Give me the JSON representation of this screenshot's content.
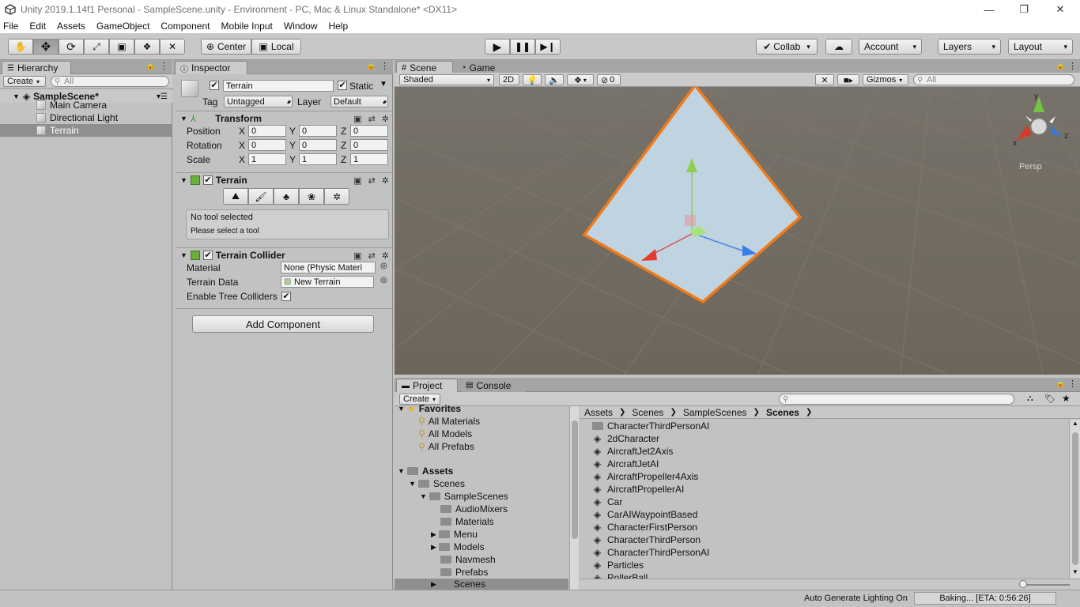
{
  "window": {
    "title": "Unity 2019.1.14f1 Personal - SampleScene.unity - Environment - PC, Mac & Linux Standalone* <DX11>",
    "minimize": "—",
    "restore": "❐",
    "close": "✕"
  },
  "menu": [
    "File",
    "Edit",
    "Assets",
    "GameObject",
    "Component",
    "Mobile Input",
    "Window",
    "Help"
  ],
  "toolbar": {
    "center": "Center",
    "local": "Local",
    "collab": "Collab",
    "account": "Account",
    "layers": "Layers",
    "layout": "Layout"
  },
  "hierarchy": {
    "tab": "Hierarchy",
    "create": "Create",
    "search_placeholder": "All",
    "scene": "SampleScene*",
    "items": [
      "Main Camera",
      "Directional Light",
      "Terrain"
    ],
    "selected": "Terrain"
  },
  "inspector": {
    "tab": "Inspector",
    "object_name": "Terrain",
    "static_label": "Static",
    "tag_label": "Tag",
    "tag_value": "Untagged",
    "layer_label": "Layer",
    "layer_value": "Default",
    "transform": {
      "title": "Transform",
      "position_label": "Position",
      "rotation_label": "Rotation",
      "scale_label": "Scale",
      "position": {
        "x": "0",
        "y": "0",
        "z": "0"
      },
      "rotation": {
        "x": "0",
        "y": "0",
        "z": "0"
      },
      "scale": {
        "x": "1",
        "y": "1",
        "z": "1"
      },
      "axis_x": "X",
      "axis_y": "Y",
      "axis_z": "Z"
    },
    "terrain": {
      "title": "Terrain",
      "info_line1": "No tool selected",
      "info_line2": "Please select a tool"
    },
    "collider": {
      "title": "Terrain Collider",
      "material_label": "Material",
      "material_value": "None (Physic Materi",
      "terrain_data_label": "Terrain Data",
      "terrain_data_value": "New Terrain",
      "tree_colliders_label": "Enable Tree Colliders"
    },
    "add_component": "Add Component"
  },
  "scene_view": {
    "tab_scene": "Scene",
    "tab_game": "Game",
    "shading": "Shaded",
    "mode_2d": "2D",
    "hidden_count": "0",
    "gizmos": "Gizmos",
    "search_placeholder": "All",
    "persp": "Persp",
    "axis_x": "x",
    "axis_y": "y",
    "axis_z": "z"
  },
  "project": {
    "tab_project": "Project",
    "tab_console": "Console",
    "create": "Create",
    "favorites": "Favorites",
    "favorite_items": [
      "All Materials",
      "All Models",
      "All Prefabs"
    ],
    "assets": "Assets",
    "scenes": "Scenes",
    "sample_scenes": "SampleScenes",
    "subfolders": [
      "AudioMixers",
      "Materials",
      "Menu",
      "Models",
      "Navmesh",
      "Prefabs",
      "Scenes"
    ],
    "breadcrumb": [
      "Assets",
      "Scenes",
      "SampleScenes",
      "Scenes"
    ],
    "files": [
      "CharacterThirdPersonAI",
      "2dCharacter",
      "AircraftJet2Axis",
      "AircraftJetAI",
      "AircraftPropeller4Axis",
      "AircraftPropellerAI",
      "Car",
      "CarAIWaypointBased",
      "CharacterFirstPerson",
      "CharacterThirdPerson",
      "CharacterThirdPersonAI",
      "Particles",
      "RollerBall"
    ]
  },
  "status": {
    "lighting": "Auto Generate Lighting On",
    "baking": "Baking... [ETA: 0:56:26]"
  }
}
